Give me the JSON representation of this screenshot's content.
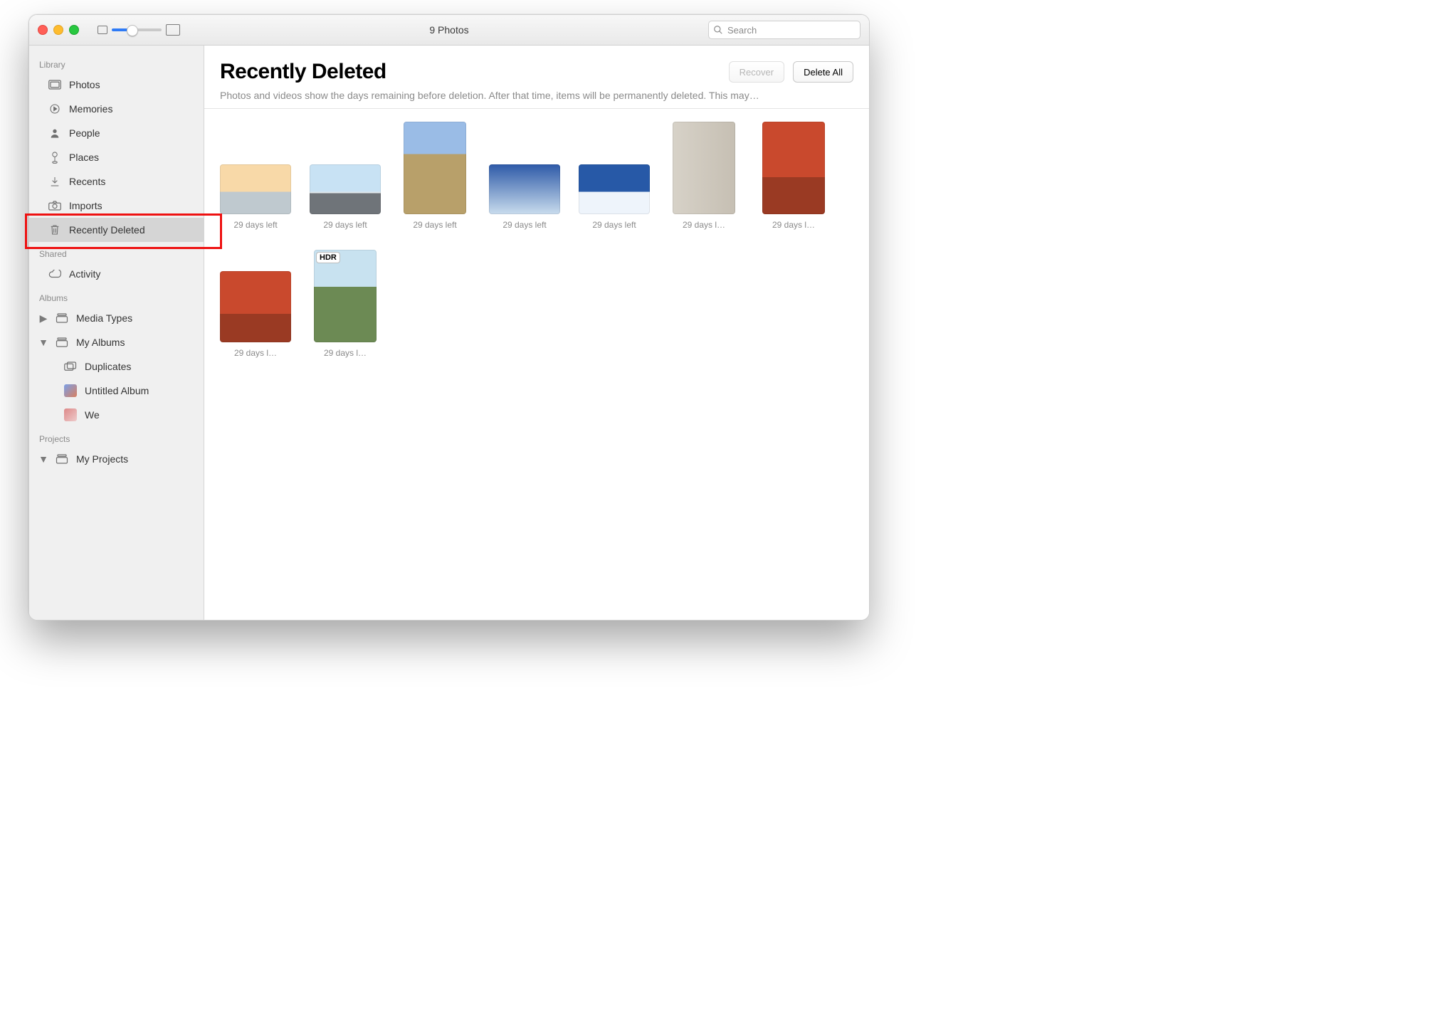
{
  "window": {
    "title": "9 Photos"
  },
  "search": {
    "placeholder": "Search"
  },
  "sidebar": {
    "sections": {
      "library": {
        "label": "Library",
        "items": [
          {
            "id": "photos",
            "label": "Photos",
            "icon": "photos-icon"
          },
          {
            "id": "memories",
            "label": "Memories",
            "icon": "memories-icon"
          },
          {
            "id": "people",
            "label": "People",
            "icon": "person-icon"
          },
          {
            "id": "places",
            "label": "Places",
            "icon": "pin-icon"
          },
          {
            "id": "recents",
            "label": "Recents",
            "icon": "download-icon"
          },
          {
            "id": "imports",
            "label": "Imports",
            "icon": "camera-icon"
          },
          {
            "id": "recently-deleted",
            "label": "Recently Deleted",
            "icon": "trash-icon",
            "selected": true,
            "highlighted": true
          }
        ]
      },
      "shared": {
        "label": "Shared",
        "items": [
          {
            "id": "activity",
            "label": "Activity",
            "icon": "cloud-icon"
          }
        ]
      },
      "albums": {
        "label": "Albums",
        "items": [
          {
            "id": "media-types",
            "label": "Media Types",
            "icon": "stack-icon",
            "disclosure": "right"
          },
          {
            "id": "my-albums",
            "label": "My Albums",
            "icon": "stack-icon",
            "disclosure": "down",
            "children": [
              {
                "id": "duplicates",
                "label": "Duplicates",
                "icon": "stack-icon"
              },
              {
                "id": "untitled",
                "label": "Untitled Album",
                "icon": "album-thumb"
              },
              {
                "id": "we",
                "label": "We",
                "icon": "album-thumb"
              }
            ]
          }
        ]
      },
      "projects": {
        "label": "Projects",
        "items": [
          {
            "id": "my-projects",
            "label": "My Projects",
            "icon": "stack-icon",
            "disclosure": "down"
          }
        ]
      }
    }
  },
  "main": {
    "title": "Recently Deleted",
    "subtext": "Photos and videos show the days remaining before deletion. After that time, items will be permanently deleted. This may…",
    "buttons": {
      "recover": "Recover",
      "delete_all": "Delete All"
    },
    "items": [
      {
        "caption": "29 days left",
        "shape": "land",
        "style": "sunset"
      },
      {
        "caption": "29 days left",
        "shape": "land",
        "style": "mountain"
      },
      {
        "caption": "29 days left",
        "shape": "port",
        "style": "vineyard"
      },
      {
        "caption": "29 days left",
        "shape": "land",
        "style": "sky1"
      },
      {
        "caption": "29 days left",
        "shape": "land",
        "style": "sky2"
      },
      {
        "caption": "29 days l…",
        "shape": "port",
        "style": "wall"
      },
      {
        "caption": "29 days l…",
        "shape": "port",
        "style": "cafe"
      },
      {
        "caption": "29 days l…",
        "shape": "sq",
        "style": "cafe"
      },
      {
        "caption": "29 days l…",
        "shape": "port",
        "style": "palm",
        "badge": "HDR"
      }
    ]
  },
  "colors": {
    "accent": "#2f7bf6",
    "highlight": "#e11"
  }
}
